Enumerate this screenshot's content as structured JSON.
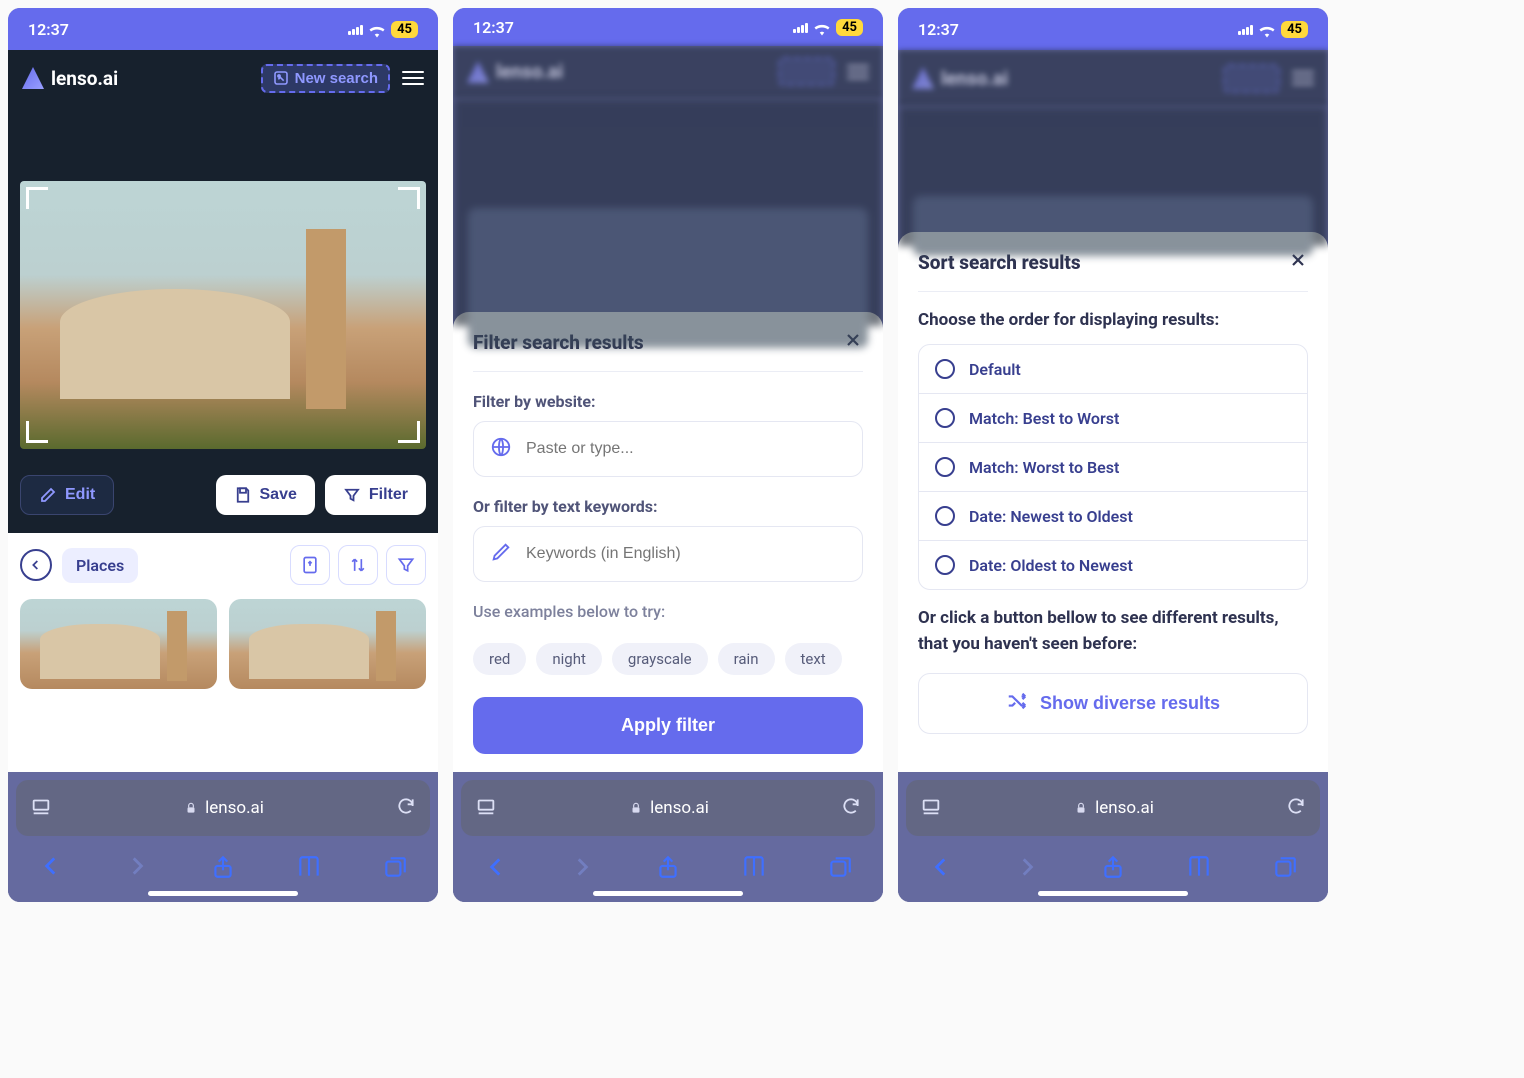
{
  "status": {
    "time": "12:37",
    "battery": "45"
  },
  "brand": {
    "name": "lenso.ai"
  },
  "header": {
    "new_search": "New search"
  },
  "actions": {
    "edit": "Edit",
    "save": "Save",
    "filter": "Filter"
  },
  "results": {
    "back_aria": "Back",
    "tag": "Places"
  },
  "safari": {
    "domain": "lenso.ai"
  },
  "filter_sheet": {
    "title": "Filter search results",
    "by_website_label": "Filter by website:",
    "website_placeholder": "Paste or type...",
    "by_keywords_label": "Or filter by text keywords:",
    "keywords_placeholder": "Keywords (in English)",
    "examples_label": "Use examples below to try:",
    "examples": [
      "red",
      "night",
      "grayscale",
      "rain",
      "text"
    ],
    "apply": "Apply filter"
  },
  "sort_sheet": {
    "title": "Sort search results",
    "desc": "Choose the order for displaying results:",
    "options": [
      "Default",
      "Match: Best to Worst",
      "Match: Worst to Best",
      "Date: Newest to Oldest",
      "Date: Oldest to Newest"
    ],
    "diverse_prompt": "Or click a button bellow to see different results, that you haven't seen before:",
    "diverse_button": "Show diverse results"
  }
}
